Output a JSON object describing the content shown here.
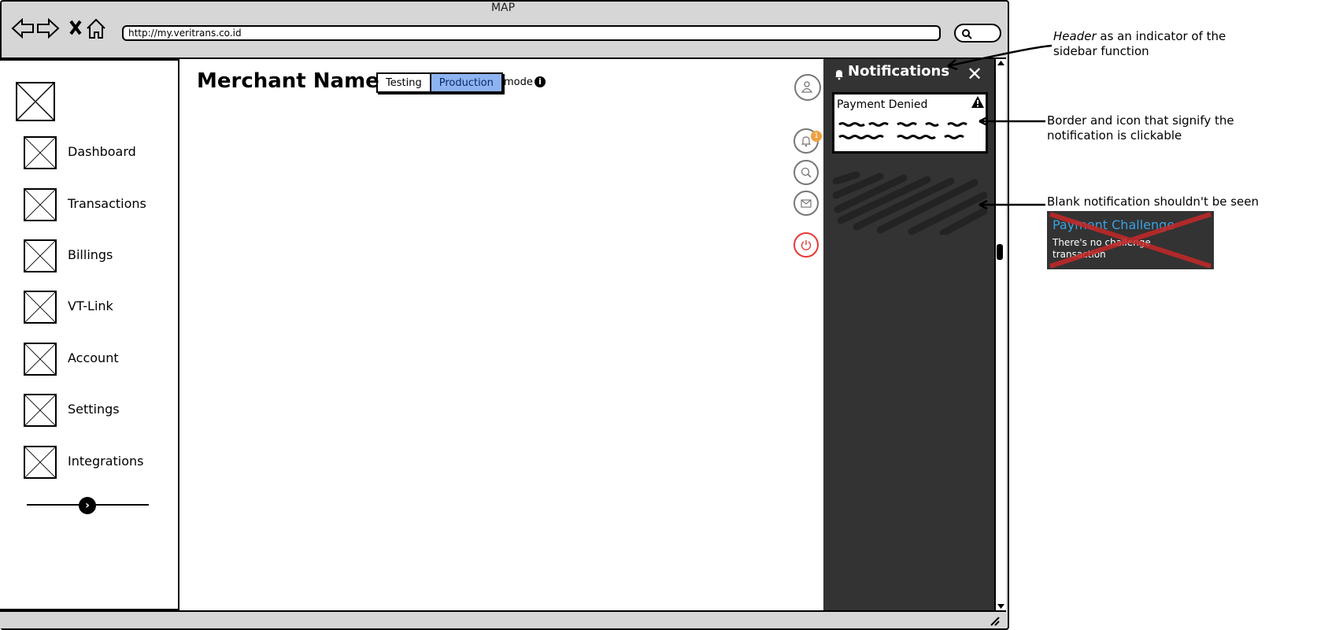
{
  "window": {
    "title": "MAP",
    "url": "http://my.veritrans.co.id"
  },
  "sidebar": {
    "items": [
      {
        "label": "Dashboard"
      },
      {
        "label": "Transactions"
      },
      {
        "label": "Billings"
      },
      {
        "label": "VT-Link"
      },
      {
        "label": "Account"
      },
      {
        "label": "Settings"
      },
      {
        "label": "Integrations"
      }
    ]
  },
  "header": {
    "merchant_name": "Merchant Name",
    "mode_options": [
      "Testing",
      "Production"
    ],
    "mode_selected": "Production",
    "mode_label": "mode",
    "notification_badge": "1"
  },
  "notifications": {
    "title": "Notifications",
    "close": "✕",
    "items": [
      {
        "title": "Payment Denied"
      }
    ]
  },
  "annotations": {
    "header_note_em": "Header",
    "header_note_rest": " as an indicator of the sidebar function",
    "border_note": "Border and icon that signify the notification is clickable",
    "blank_note": "Blank notification shouldn't be seen",
    "sample_title": "Payment Challenge",
    "sample_body": "There's no challenge transaction"
  },
  "colors": {
    "panel": "#333333",
    "mode_active": "#8db3f0",
    "power": "#e53935",
    "badge": "#f0a040",
    "sample_title": "#3aa0e0",
    "strike": "#c62828"
  }
}
